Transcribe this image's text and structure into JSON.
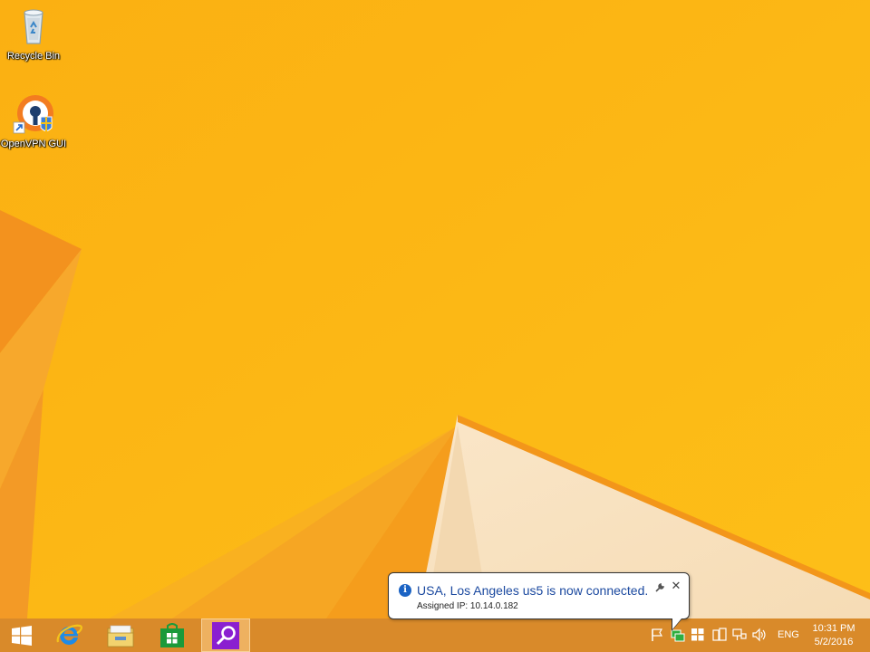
{
  "desktop": {
    "icons": [
      {
        "label": "Recycle Bin",
        "icon": "recycle-bin-icon"
      },
      {
        "label": "OpenVPN GUI",
        "icon": "openvpn-gui-icon"
      }
    ]
  },
  "taskbar": {
    "pinned": [
      {
        "name": "start",
        "icon": "windows-logo-icon"
      },
      {
        "name": "internet-explorer",
        "icon": "internet-explorer-icon"
      },
      {
        "name": "file-explorer",
        "icon": "folder-icon"
      },
      {
        "name": "store",
        "icon": "store-icon"
      },
      {
        "name": "search-app",
        "icon": "magnifier-icon"
      }
    ],
    "tray": {
      "icons": [
        "action-center-flag-icon",
        "openvpn-connected-icon",
        "windows-icon",
        "device-icon",
        "network-icon",
        "volume-icon"
      ],
      "language": "ENG",
      "time": "10:31 PM",
      "date": "5/2/2016"
    }
  },
  "notification": {
    "title": "USA, Los Angeles us5 is now connected.",
    "body": "Assigned IP: 10.14.0.182",
    "icon": "info-icon",
    "close_glyph": "✕"
  },
  "colors": {
    "wallpaper_main": "#FDB913",
    "wallpaper_orange": "#F28C1E",
    "taskbar": "#D98A2A",
    "notification_title": "#1C4AA0"
  }
}
